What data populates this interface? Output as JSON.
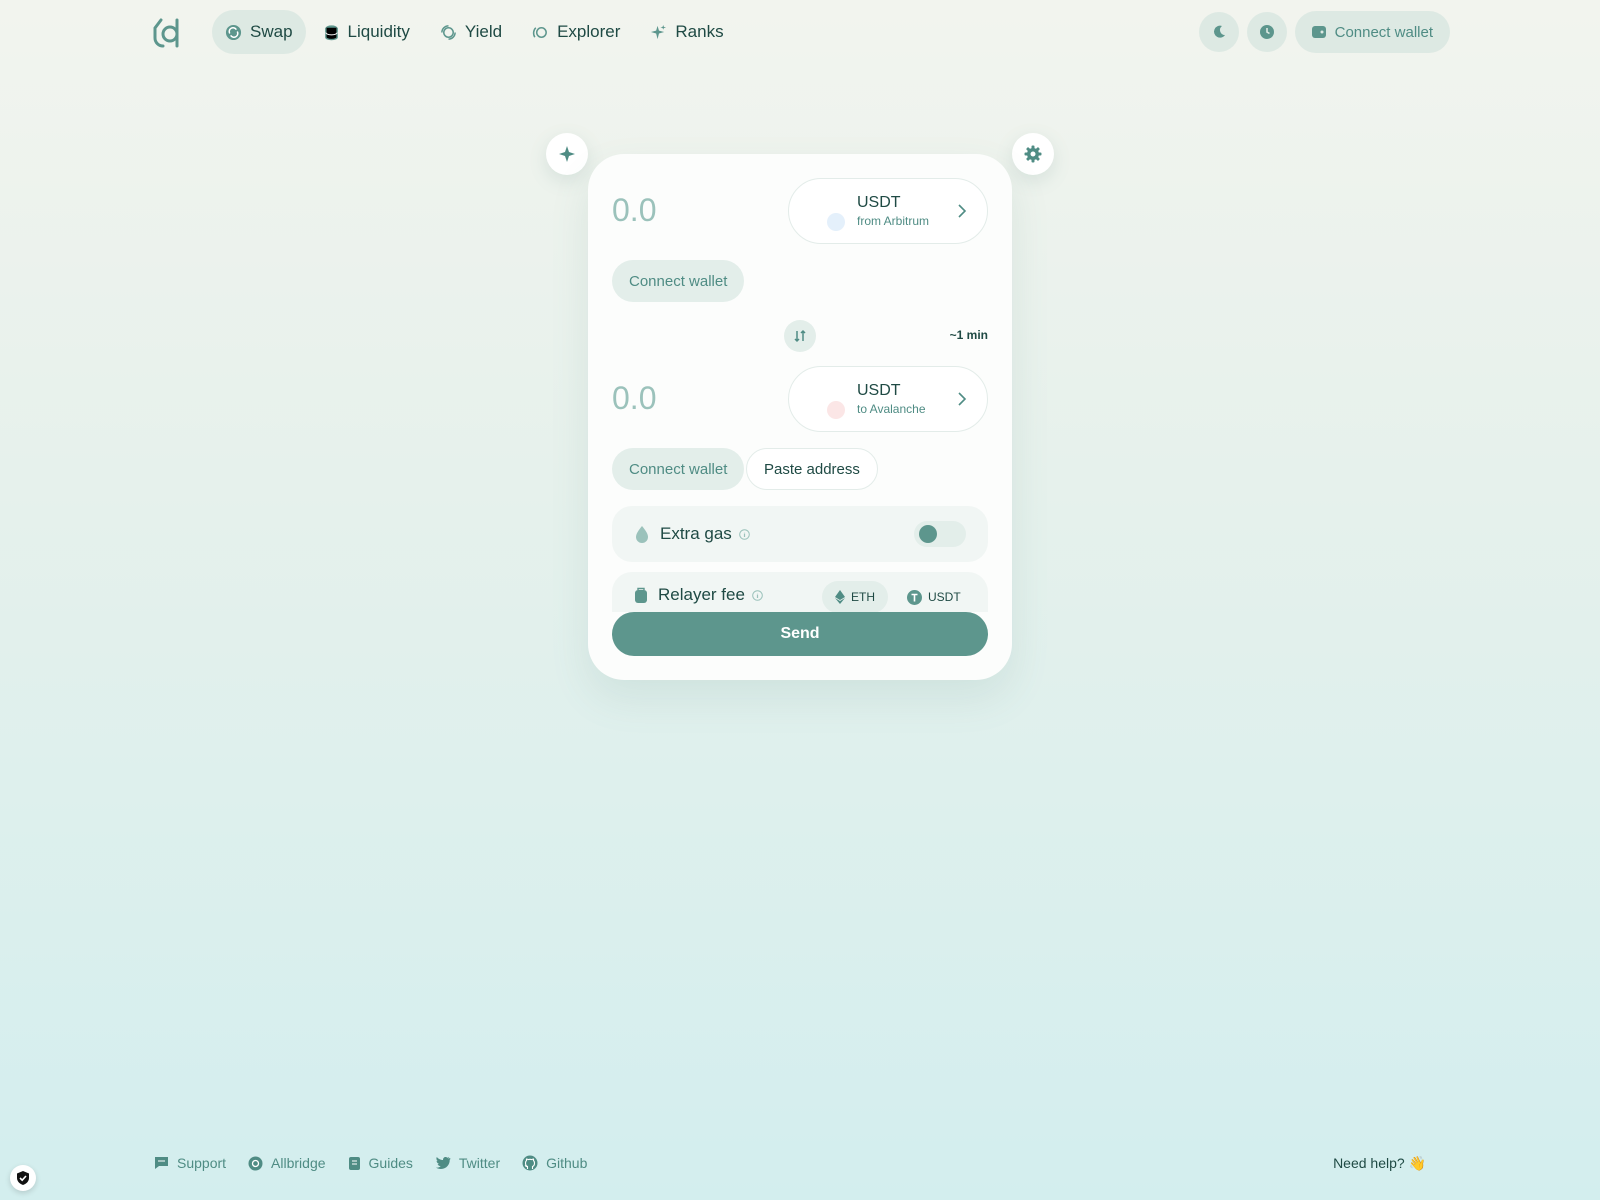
{
  "colors": {
    "accent": "#5d968d",
    "text": "#1f4a44",
    "muted": "#4f8c84",
    "placeholder": "#9bc2bb"
  },
  "header": {
    "logo": "allbridge-logo",
    "nav": [
      {
        "label": "Swap",
        "icon": "swap-circle-icon",
        "active": true
      },
      {
        "label": "Liquidity",
        "icon": "coins-stack-icon"
      },
      {
        "label": "Yield",
        "icon": "yield-icon"
      },
      {
        "label": "Explorer",
        "icon": "explorer-icon"
      },
      {
        "label": "Ranks",
        "icon": "sparkle-icon"
      }
    ],
    "theme_icon": "moon-icon",
    "history_icon": "clock-icon",
    "connect_wallet": "Connect wallet"
  },
  "swap": {
    "from": {
      "amount": "0.0",
      "token": "USDT",
      "chain": "from Arbitrum",
      "dot_color": "#e4f0fb"
    },
    "to": {
      "amount": "0.0",
      "token": "USDT",
      "chain": "to Avalanche",
      "dot_color": "#fbe6e6"
    },
    "connect_wallet": "Connect wallet",
    "paste_address": "Paste address",
    "eta": "~1 min",
    "extra_gas": {
      "label": "Extra gas",
      "enabled": false
    },
    "relayer_fee": {
      "label": "Relayer fee",
      "options": [
        "ETH",
        "USDT"
      ],
      "selected": "ETH"
    },
    "send": "Send"
  },
  "footer": {
    "links": [
      {
        "label": "Support",
        "icon": "chat-icon"
      },
      {
        "label": "Allbridge",
        "icon": "allbridge-icon"
      },
      {
        "label": "Guides",
        "icon": "book-icon"
      },
      {
        "label": "Twitter",
        "icon": "twitter-icon"
      },
      {
        "label": "Github",
        "icon": "github-icon"
      }
    ],
    "help": "Need help? 👋"
  }
}
